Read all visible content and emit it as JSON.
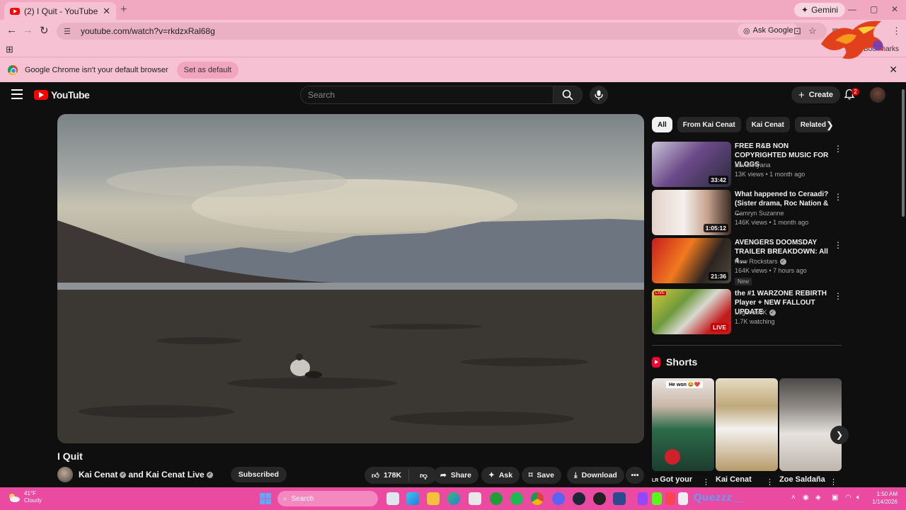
{
  "browser": {
    "tab_title": "(2) I Quit - YouTube",
    "tab_close": "✕",
    "new_tab": "+",
    "gemini_label": "Gemini",
    "url": "youtube.com/watch?v=rkdzxRal68g",
    "ask_google": "Ask Google",
    "all_bookmarks": "All Bookmarks",
    "infobar_message": "Google Chrome isn't your default browser",
    "set_default": "Set as default"
  },
  "youtube": {
    "logo_text": "YouTube",
    "search_placeholder": "Search",
    "create_label": "Create",
    "notification_count": "2",
    "video_title": "I Quit",
    "channel_names": "Kai Cenat",
    "channel_and": "and Kai Cenat Live",
    "subscribed_label": "Subscribed",
    "like_count": "178K",
    "share_label": "Share",
    "ask_label": "Ask",
    "save_label": "Save",
    "download_label": "Download",
    "chips": [
      "All",
      "From Kai Cenat",
      "Kai Cenat",
      "Related"
    ],
    "recommendations": [
      {
        "title": "FREE R&B NON COPYRIGHTED MUSIC FOR VLOGS",
        "channel": "Lavishhyana",
        "meta": "13K views • 1 month ago",
        "duration": "33:42",
        "verified": false
      },
      {
        "title": "What happened to Ceraadi? (Sister drama, Roc Nation & ...",
        "channel": "Camryn Suzanne",
        "meta": "146K views • 1 month ago",
        "duration": "1:05:12",
        "verified": false
      },
      {
        "title": "AVENGERS DOOMSDAY TRAILER BREAKDOWN: All 4 ...",
        "channel": "New Rockstars",
        "meta": "164K views • 7 hours ago",
        "duration": "21:36",
        "badge": "New",
        "verified": true
      },
      {
        "title": "the #1 WARZONE REBIRTH Player + NEW FALLOUT UPDATE",
        "channel": "Legends6K",
        "meta": "1.7K watching",
        "duration": "LIVE",
        "verified": true
      }
    ],
    "shorts_heading": "Shorts",
    "shorts": [
      {
        "label": "Got your",
        "overlay": "He won 😂❤️"
      },
      {
        "label": "Kai Cenat",
        "overlay": ""
      },
      {
        "label": "Zoe Saldaña",
        "overlay": ""
      }
    ]
  },
  "taskbar": {
    "temp": "41°F",
    "condition": "Cloudy",
    "search_placeholder": "Search",
    "quezzz": "Quezzz__",
    "time": "1:50 AM",
    "date": "1/14/2026"
  },
  "colors": {
    "tab_strip": "#f1a9c2",
    "chrome_bg": "#f6c1d3",
    "youtube_bg": "#0f0f0f",
    "youtube_red": "#ff0000",
    "taskbar": "#ea4aa0"
  }
}
